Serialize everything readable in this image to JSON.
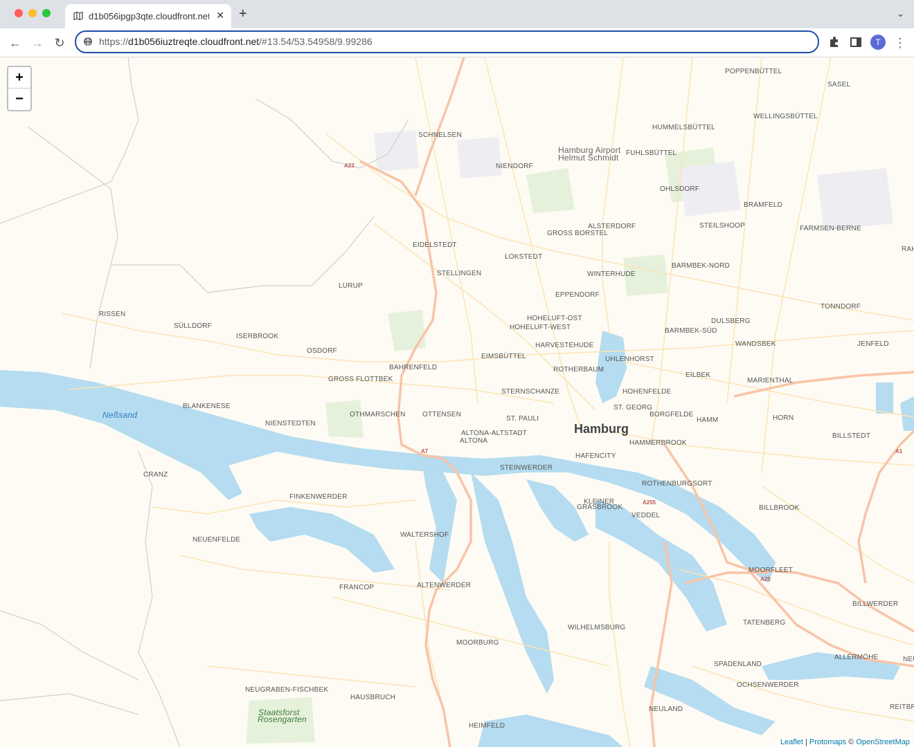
{
  "browser": {
    "tab_title": "d1b056ipgp3qte.cloudfront.net",
    "tab_close": "✕",
    "new_tab": "+",
    "tab_list": "⌄",
    "url_host": "d1b056iuztreqte.cloudfront.net",
    "url_scheme": "https://",
    "url_path": "/#13.54/53.54958/9.99286",
    "avatar_letter": "T",
    "back": "←",
    "forward": "→",
    "reload": "↻",
    "menu": "⋮"
  },
  "map": {
    "zoom_in": "+",
    "zoom_out": "−",
    "attribution": {
      "leaflet": "Leaflet",
      "separator": " | ",
      "protomaps": "Protomaps",
      "copyright": " © ",
      "osm": "OpenStreetMap"
    },
    "city": "Hamburg",
    "places": [
      "POPPENBÜTTEL",
      "SASEL",
      "WELLINGSBÜTTEL",
      "HUMMELSBÜTTEL",
      "SCHNELSEN",
      "FUHLSBÜTTEL",
      "NIENDORF",
      "OHLSDORF",
      "BRAMFELD",
      "ALSTERDORF",
      "GROSS BORSTEL",
      "STEILSHOOP",
      "FARMSEN-BERNE",
      "EIDELSTEDT",
      "LOKSTEDT",
      "BARMBEK-NORD",
      "STELLINGEN",
      "WINTERHUDE",
      "LURUP",
      "EPPENDORF",
      "TONNDORF",
      "RISSEN",
      "SÜLLDORF",
      "HOHELUFT-OST",
      "HOHELUFT-WEST",
      "DULSBERG",
      "ISERBROOK",
      "BARMBEK-SÜD",
      "HARVESTEHUDE",
      "WANDSBEK",
      "JENFELD",
      "OSDORF",
      "EIMSBÜTTEL",
      "UHLENHORST",
      "BAHRENFELD",
      "ROTHERBAUM",
      "EILBEK",
      "GROSS FLOTTBEK",
      "MARIENTHAL",
      "STERNSCHANZE",
      "HOHENFELDE",
      "BLANKENESE",
      "ST. GEORG",
      "OTHMARSCHEN",
      "OTTENSEN",
      "BORGFELDE",
      "ST. PAULI",
      "HAMM",
      "HORN",
      "NIENSTEDTEN",
      "ALTONA-ALTSTADT",
      "ALTONA",
      "BILLSTEDT",
      "HAMMERBROOK",
      "HAFENCITY",
      "STEINWERDER",
      "CRANZ",
      "ROTHENBURGSORT",
      "FINKENWERDER",
      "KLEINER",
      "GRASBROOK",
      "VEDDEL",
      "BILLBROOK",
      "WALTERSHOF",
      "NEUENFELDE",
      "MOORFLEET",
      "FRANCOP",
      "ALTENWERDER",
      "BILLWERDER",
      "TATENBERG",
      "WILHELMSBURG",
      "MOORBURG",
      "ALLERMÖHE",
      "SPADENLAND",
      "OCHSENWERDER",
      "NEUGRABEN-FISCHBEK",
      "HAUSBRUCH",
      "NEULAND",
      "REITBR",
      "HEIMFELD",
      "RAH",
      "NEU"
    ],
    "water_labels": [
      "Neßsand"
    ],
    "poi_labels": [
      "Hamburg Airport",
      "Helmut Schmidt"
    ],
    "park_labels": [
      "Staatsforst",
      "Rosengarten"
    ],
    "road_shields": [
      "A23",
      "A7",
      "A255",
      "A25",
      "A1"
    ],
    "colors": {
      "land": "#fdfbf4",
      "water": "#b5dcf0",
      "major_road": "#f8c4a8",
      "minor_road": "#fde3b4",
      "park": "#e3f0d8",
      "boundary": "#c8c8c8"
    }
  }
}
